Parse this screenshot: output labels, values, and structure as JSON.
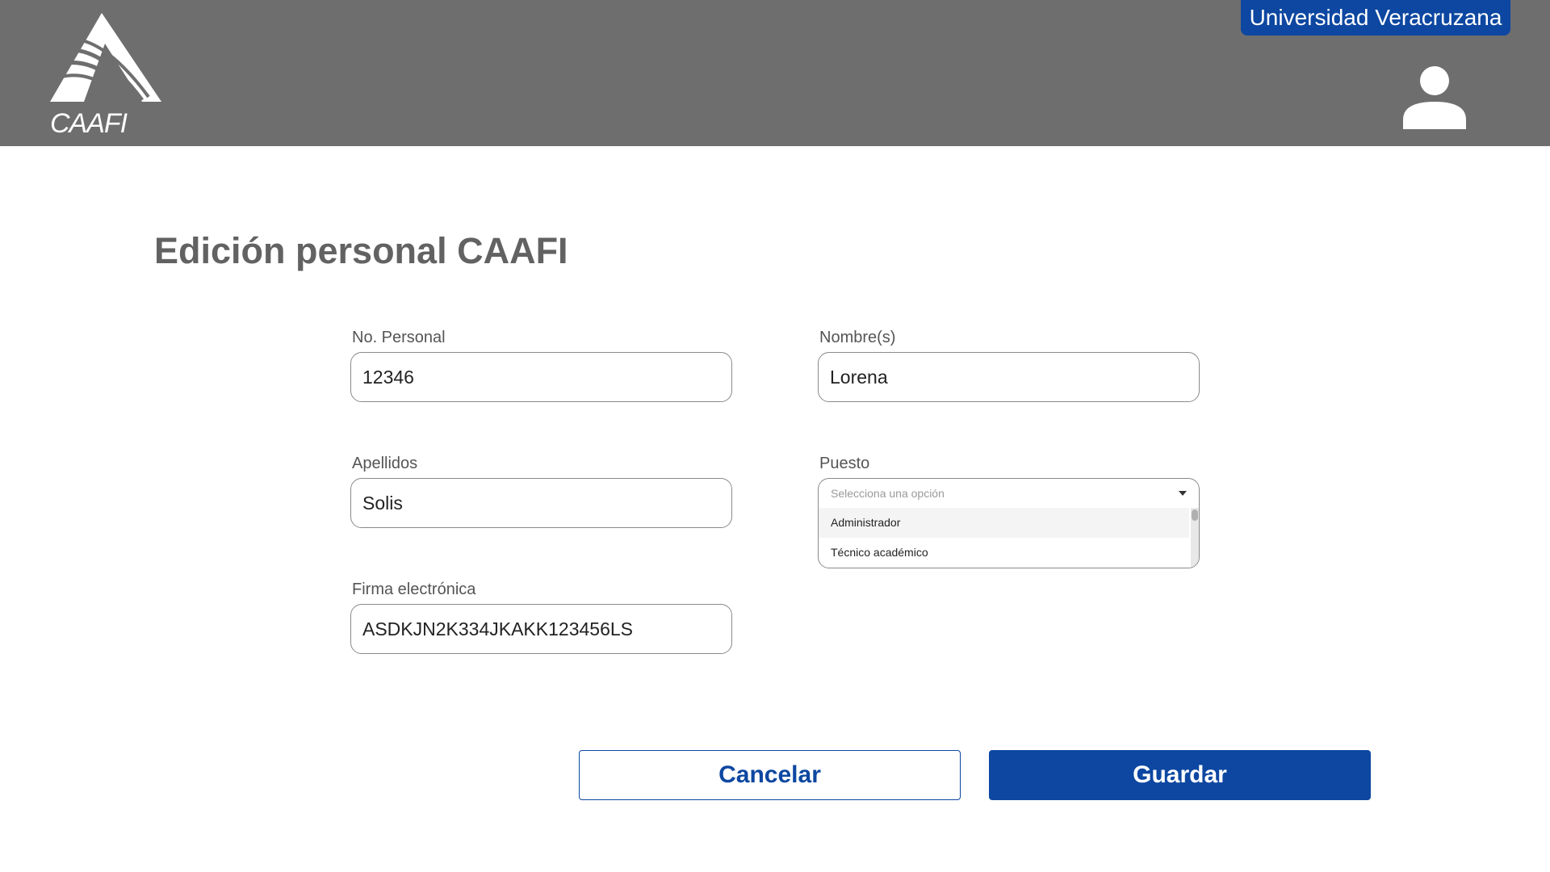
{
  "header": {
    "logo_text": "CAAFI",
    "university_label": "Universidad Veracruzana",
    "user_icon": "user-icon"
  },
  "page": {
    "title": "Edición personal CAAFI"
  },
  "form": {
    "no_personal": {
      "label": "No. Personal",
      "value": "12346"
    },
    "nombres": {
      "label": "Nombre(s)",
      "value": "Lorena"
    },
    "apellidos": {
      "label": "Apellidos",
      "value": "Solis"
    },
    "puesto": {
      "label": "Puesto",
      "placeholder": "Selecciona una opción",
      "options": [
        "Administrador",
        "Técnico académico"
      ]
    },
    "firma": {
      "label": "Firma electrónica",
      "value": "ASDKJN2K334JKAKK123456LS"
    }
  },
  "actions": {
    "cancel_label": "Cancelar",
    "save_label": "Guardar"
  },
  "colors": {
    "header_bg": "#6e6e6e",
    "accent": "#0d47a1"
  }
}
